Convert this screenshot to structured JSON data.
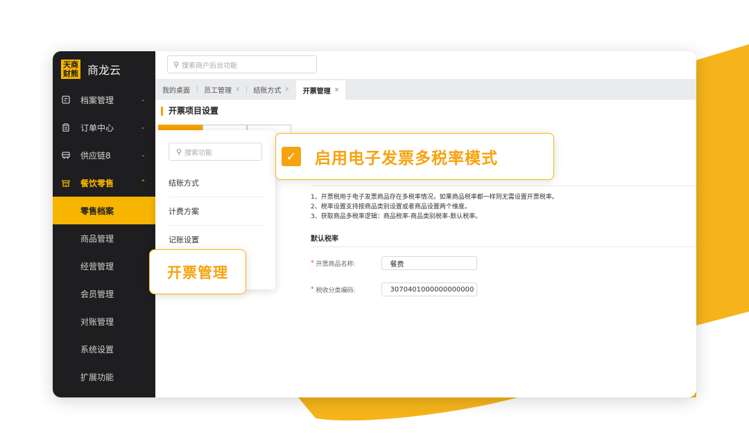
{
  "brand": {
    "logo_text": "天商财熊",
    "app_name": "商龙云",
    "accent": "#f7b500"
  },
  "top_search": {
    "placeholder": "搜索商户后台功能"
  },
  "sidebar": {
    "items": [
      {
        "label": "档案管理",
        "icon": "archive-icon"
      },
      {
        "label": "订单中心",
        "icon": "clipboard-icon"
      },
      {
        "label": "供应链8",
        "icon": "truck-icon"
      },
      {
        "label": "餐饮零售",
        "icon": "store-icon"
      }
    ],
    "sub_items": [
      {
        "label": "零售档案"
      },
      {
        "label": "商品管理"
      },
      {
        "label": "经营管理"
      },
      {
        "label": "会员管理"
      },
      {
        "label": "对账管理"
      },
      {
        "label": "系统设置"
      },
      {
        "label": "扩展功能"
      }
    ]
  },
  "tabs": [
    {
      "label": "我的桌面"
    },
    {
      "label": "员工管理",
      "close": "x"
    },
    {
      "label": "结账方式",
      "close": "x"
    },
    {
      "label": "开票管理",
      "close": "x"
    }
  ],
  "content": {
    "section_title": "开票项目设置",
    "desc_lines": [
      "1、开票税用于电子发票商品存在多税率情况，如果商品税率都一样则无需设置开票税率。",
      "2、税率设置支持按商品类别设置或者商品设置两个维度。",
      "3、获取商品多税率逻辑：商品税率-商品类别税率-默认税率。"
    ],
    "default_tax_heading": "默认税率",
    "fields": [
      {
        "label": "开票商品名称:",
        "value": "餐费"
      },
      {
        "label": "税收分类编码:",
        "value": "3070401000000000000"
      }
    ]
  },
  "popup": {
    "search_placeholder": "搜索功能",
    "items": [
      {
        "label": "结账方式"
      },
      {
        "label": "计费方案"
      },
      {
        "label": "记账设置"
      }
    ]
  },
  "callouts": {
    "multi_tax": "启用电子发票多税率模式",
    "invoice_mgmt": "开票管理"
  }
}
